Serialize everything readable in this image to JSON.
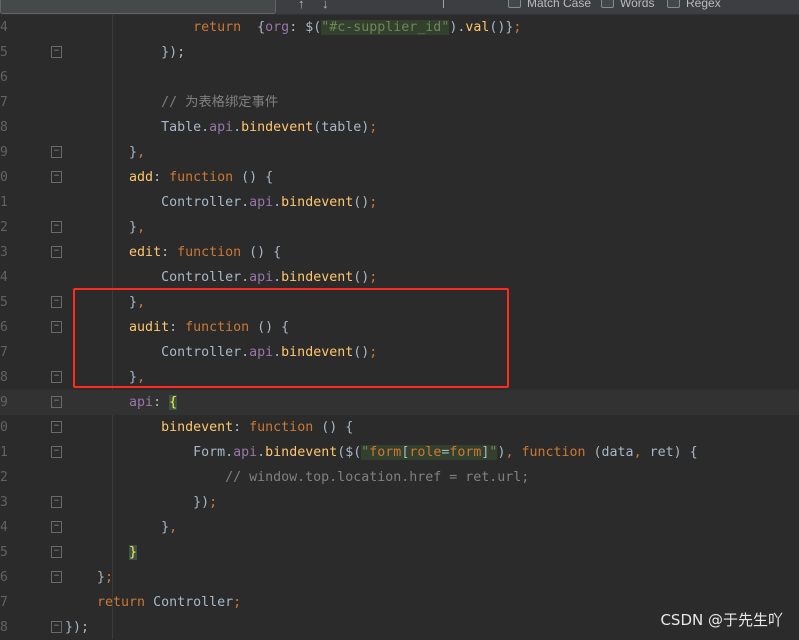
{
  "toolbar": {
    "match_case_label": "Match Case",
    "words_label": "Words",
    "regex_label": "Regex"
  },
  "colors": {
    "background": "#2b2b2b",
    "keyword": "#cc7832",
    "property": "#9876aa",
    "method": "#ffc66d",
    "text": "#a9b7c6",
    "string": "#6a8759",
    "comment": "#808080",
    "annotation_box": "#ff2a1f"
  },
  "editor": {
    "current_line_index": 15,
    "highlight_box_lines": [
      11,
      14
    ],
    "lines": [
      {
        "num": "4",
        "fold": false,
        "tokens": [
          [
            "d",
            "                "
          ],
          [
            "k",
            "return"
          ],
          [
            "d",
            "  {"
          ],
          [
            "p",
            "org"
          ],
          [
            "d",
            ": $("
          ],
          [
            "s",
            "\"#c-supplier_id\""
          ],
          [
            "d",
            ")."
          ],
          [
            "m",
            "val"
          ],
          [
            "d",
            "()}"
          ],
          [
            "k",
            ";"
          ]
        ]
      },
      {
        "num": "5",
        "fold": true,
        "tokens": [
          [
            "d",
            "            });"
          ]
        ]
      },
      {
        "num": "6",
        "fold": false,
        "tokens": []
      },
      {
        "num": "7",
        "fold": false,
        "tokens": [
          [
            "c",
            "            // 为表格绑定事件"
          ]
        ]
      },
      {
        "num": "8",
        "fold": false,
        "tokens": [
          [
            "d",
            "            Table."
          ],
          [
            "p",
            "api"
          ],
          [
            "d",
            "."
          ],
          [
            "m",
            "bindevent"
          ],
          [
            "d",
            "(table)"
          ],
          [
            "k",
            ";"
          ]
        ]
      },
      {
        "num": "9",
        "fold": true,
        "tokens": [
          [
            "d",
            "        }"
          ],
          [
            "k",
            ","
          ]
        ]
      },
      {
        "num": "0",
        "fold": true,
        "tokens": [
          [
            "d",
            "        "
          ],
          [
            "m",
            "add"
          ],
          [
            "d",
            ": "
          ],
          [
            "k",
            "function"
          ],
          [
            "d",
            " () {"
          ]
        ]
      },
      {
        "num": "1",
        "fold": false,
        "tokens": [
          [
            "d",
            "            Controller."
          ],
          [
            "p",
            "api"
          ],
          [
            "d",
            "."
          ],
          [
            "m",
            "bindevent"
          ],
          [
            "d",
            "()"
          ],
          [
            "k",
            ";"
          ]
        ]
      },
      {
        "num": "2",
        "fold": true,
        "tokens": [
          [
            "d",
            "        }"
          ],
          [
            "k",
            ","
          ]
        ]
      },
      {
        "num": "3",
        "fold": true,
        "tokens": [
          [
            "d",
            "        "
          ],
          [
            "m",
            "edit"
          ],
          [
            "d",
            ": "
          ],
          [
            "k",
            "function"
          ],
          [
            "d",
            " () {"
          ]
        ]
      },
      {
        "num": "4",
        "fold": false,
        "tokens": [
          [
            "d",
            "            Controller."
          ],
          [
            "p",
            "api"
          ],
          [
            "d",
            "."
          ],
          [
            "m",
            "bindevent"
          ],
          [
            "d",
            "()"
          ],
          [
            "k",
            ";"
          ]
        ]
      },
      {
        "num": "5",
        "fold": true,
        "tokens": [
          [
            "d",
            "        }"
          ],
          [
            "k",
            ","
          ]
        ]
      },
      {
        "num": "6",
        "fold": true,
        "tokens": [
          [
            "d",
            "        "
          ],
          [
            "m",
            "audit"
          ],
          [
            "d",
            ": "
          ],
          [
            "k",
            "function"
          ],
          [
            "d",
            " () {"
          ]
        ]
      },
      {
        "num": "7",
        "fold": false,
        "tokens": [
          [
            "d",
            "            Controller."
          ],
          [
            "p",
            "api"
          ],
          [
            "d",
            "."
          ],
          [
            "m",
            "bindevent"
          ],
          [
            "d",
            "()"
          ],
          [
            "k",
            ";"
          ]
        ]
      },
      {
        "num": "8",
        "fold": true,
        "tokens": [
          [
            "d",
            "        }"
          ],
          [
            "k",
            ","
          ]
        ]
      },
      {
        "num": "9",
        "fold": true,
        "tokens": [
          [
            "d",
            "        "
          ],
          [
            "p",
            "api"
          ],
          [
            "d",
            ": "
          ],
          [
            "b",
            "{"
          ]
        ]
      },
      {
        "num": "0",
        "fold": true,
        "tokens": [
          [
            "d",
            "            "
          ],
          [
            "m",
            "bindevent"
          ],
          [
            "d",
            ": "
          ],
          [
            "k",
            "function"
          ],
          [
            "d",
            " () {"
          ]
        ]
      },
      {
        "num": "1",
        "fold": true,
        "tokens": [
          [
            "d",
            "                Form."
          ],
          [
            "p",
            "api"
          ],
          [
            "d",
            "."
          ],
          [
            "m",
            "bindevent"
          ],
          [
            "d",
            "($("
          ],
          [
            "s",
            "\""
          ],
          [
            "sk",
            "form"
          ],
          [
            "sv",
            "["
          ],
          [
            "sk",
            "role"
          ],
          [
            "sv",
            "="
          ],
          [
            "sk",
            "form"
          ],
          [
            "sv",
            "]"
          ],
          [
            "s",
            "\""
          ],
          [
            "d",
            ")"
          ],
          [
            "k",
            ", function"
          ],
          [
            "d",
            " (data"
          ],
          [
            "k",
            ","
          ],
          [
            "d",
            " ret) {"
          ]
        ]
      },
      {
        "num": "2",
        "fold": false,
        "tokens": [
          [
            "c",
            "                    // window.top.location.href = ret.url;"
          ]
        ]
      },
      {
        "num": "3",
        "fold": true,
        "tokens": [
          [
            "d",
            "                })"
          ],
          [
            "k",
            ";"
          ]
        ]
      },
      {
        "num": "4",
        "fold": true,
        "tokens": [
          [
            "d",
            "            }"
          ],
          [
            "k",
            ","
          ]
        ]
      },
      {
        "num": "5",
        "fold": true,
        "tokens": [
          [
            "d",
            "        "
          ],
          [
            "b",
            "}"
          ]
        ]
      },
      {
        "num": "6",
        "fold": true,
        "tokens": [
          [
            "d",
            "    }"
          ],
          [
            "k",
            ";"
          ]
        ]
      },
      {
        "num": "7",
        "fold": false,
        "tokens": [
          [
            "d",
            "    "
          ],
          [
            "k",
            "return"
          ],
          [
            "d",
            " Controller"
          ],
          [
            "k",
            ";"
          ]
        ]
      },
      {
        "num": "8",
        "fold": true,
        "tokens": [
          [
            "d",
            "});"
          ]
        ]
      }
    ]
  },
  "watermark": "CSDN @于先生吖"
}
